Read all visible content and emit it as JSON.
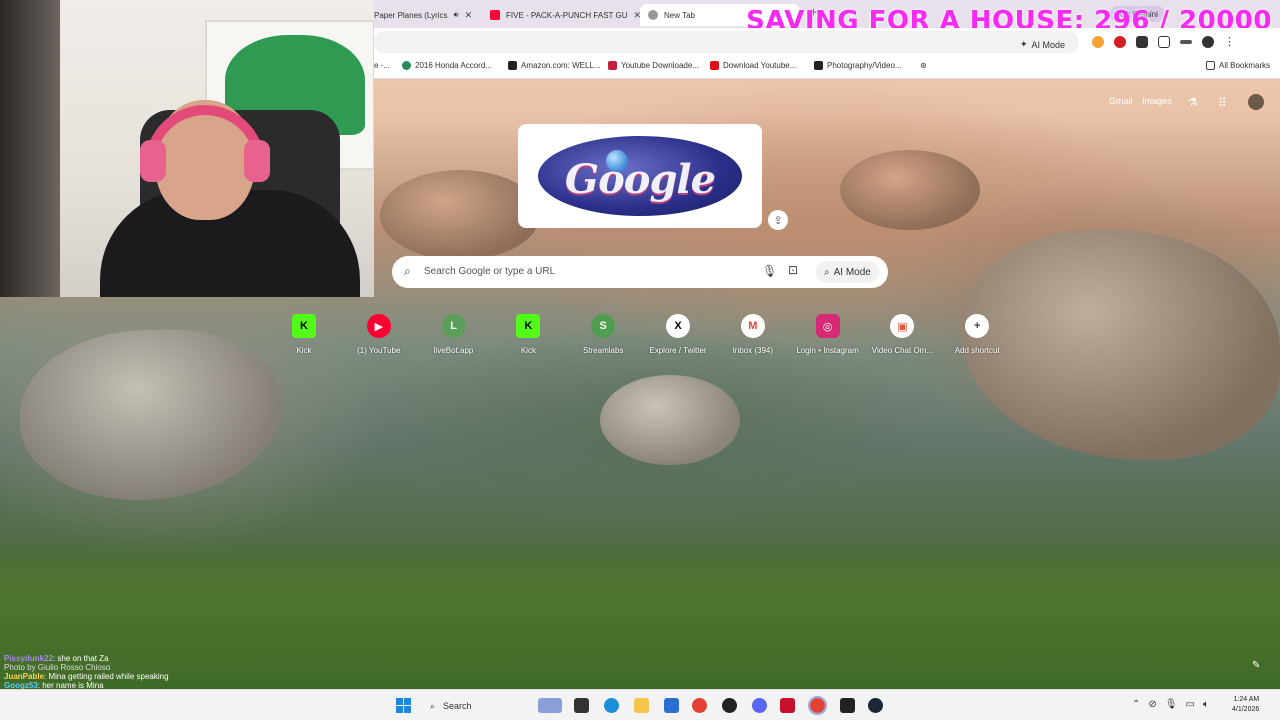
{
  "overlay": {
    "title": "SAVING FOR A HOUSE: 296 / 20000"
  },
  "browser": {
    "tabs": [
      {
        "label": "Paper Planes (Lyrics",
        "icon": "speaker-icon"
      },
      {
        "label": "FIVE - PACK-A-PUNCH FAST GU",
        "icon": "youtube-icon"
      },
      {
        "label": "New Tab",
        "icon": "newtab-icon",
        "active": true
      }
    ],
    "ask_gemini": "Ask Gemini",
    "omnibox_ai_mode": "AI Mode",
    "bookmarks": [
      {
        "label": "e -...",
        "icon": "page-icon"
      },
      {
        "label": "2016 Honda Accord...",
        "icon": "page-icon"
      },
      {
        "label": "Amazon.com: WELL...",
        "icon": "amazon-icon"
      },
      {
        "label": "Youtube Downloade...",
        "icon": "page-icon"
      },
      {
        "label": "Download Youtube...",
        "icon": "youtube-icon"
      },
      {
        "label": "Photography/Video...",
        "icon": "page-icon"
      }
    ],
    "all_bookmarks": "All Bookmarks"
  },
  "google": {
    "header_links": [
      "Gmail",
      "Images"
    ],
    "doodle_text": "Google",
    "search_placeholder": "Search Google or type a URL",
    "ai_mode_label": "AI Mode",
    "shortcuts": [
      {
        "label": "Kick",
        "icon": "kick-icon",
        "color": "#53fc18",
        "glyph": "K"
      },
      {
        "label": "(1) YouTube",
        "icon": "youtube-icon",
        "color": "#ff0033",
        "glyph": "▶"
      },
      {
        "label": "liveBot.app",
        "icon": "livebot-icon",
        "color": "#5a9e5a",
        "glyph": "L"
      },
      {
        "label": "Kick",
        "icon": "kick-icon",
        "color": "#53fc18",
        "glyph": "K"
      },
      {
        "label": "Streamlabs",
        "icon": "streamlabs-icon",
        "color": "#4f9e4f",
        "glyph": "S"
      },
      {
        "label": "Explore / Twitter",
        "icon": "x-icon",
        "color": "#000000",
        "glyph": "X"
      },
      {
        "label": "Inbox (394)",
        "icon": "gmail-icon",
        "color": "#ea4335",
        "glyph": "M"
      },
      {
        "label": "Login • Instagram",
        "icon": "instagram-icon",
        "color": "#d62976",
        "glyph": "◎"
      },
      {
        "label": "Video Chat Om...",
        "icon": "videochat-icon",
        "color": "#e8553a",
        "glyph": "▣"
      },
      {
        "label": "Add shortcut",
        "icon": "plus-icon",
        "color": "#444444",
        "glyph": "+"
      }
    ]
  },
  "chat": [
    {
      "user": "Pissydunk22",
      "msg": ": she on that Za"
    },
    {
      "user": "",
      "msg": "Photo by Giulio Rosso Chioso"
    },
    {
      "user": "JuanPable",
      "msg": ": Mina getting railed while speaking"
    },
    {
      "user": "Googz53",
      "msg": ": her name is Mina"
    }
  ],
  "taskbar": {
    "search_label": "Search",
    "time": "1:24 AM",
    "date": "4/1/2026"
  },
  "colors": {
    "overlay_magenta": "#f62af3",
    "windows_blue": "#1d86e0"
  }
}
